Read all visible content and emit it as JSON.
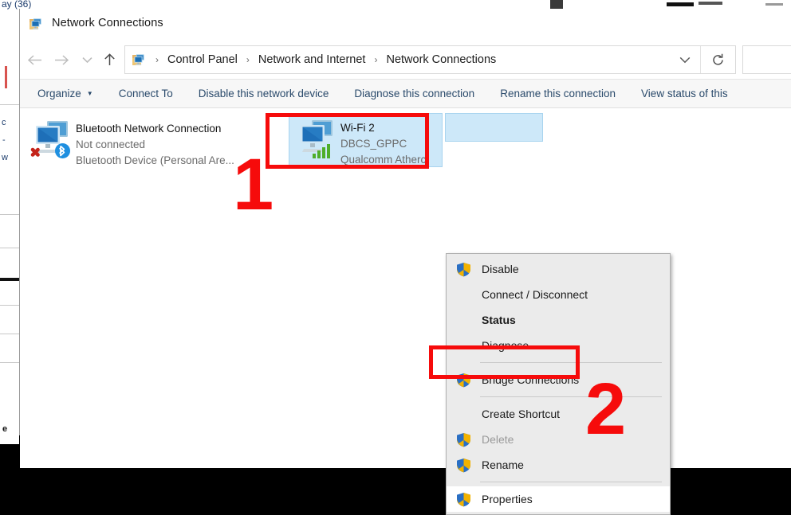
{
  "window": {
    "title": "Network Connections",
    "title_icon": "network-connections-icon"
  },
  "navigation": {
    "back_icon": "←",
    "forward_icon": "→",
    "recent_icon": "⌄",
    "up_icon": "↑",
    "breadcrumb": [
      "Control Panel",
      "Network and Internet",
      "Network Connections"
    ],
    "separator": "›",
    "chevron_icon": "⌄",
    "refresh_icon": "↻"
  },
  "commandbar": {
    "items": [
      {
        "label": "Organize",
        "has_caret": true
      },
      {
        "label": "Connect To",
        "has_caret": false
      },
      {
        "label": "Disable this network device",
        "has_caret": false
      },
      {
        "label": "Diagnose this connection",
        "has_caret": false
      },
      {
        "label": "Rename this connection",
        "has_caret": false
      },
      {
        "label": "View status of this",
        "has_caret": false
      }
    ],
    "caret": "▼"
  },
  "adapters": [
    {
      "name": "Bluetooth Network Connection",
      "status": "Not connected",
      "device": "Bluetooth Device (Personal Are...",
      "selected": false,
      "icon": "network-adapter-disconnected-bluetooth-icon"
    },
    {
      "name": "Wi-Fi 2",
      "status": "DBCS_GPPC",
      "device": "Qualcomm Atherc",
      "selected": true,
      "icon": "network-adapter-wifi-icon"
    }
  ],
  "context_menu": {
    "items": [
      {
        "label": "Disable",
        "shield": true,
        "bold": false,
        "disabled": false,
        "separator_after": false,
        "highlight": false
      },
      {
        "label": "Connect / Disconnect",
        "shield": false,
        "bold": false,
        "disabled": false,
        "separator_after": false,
        "highlight": false
      },
      {
        "label": "Status",
        "shield": false,
        "bold": true,
        "disabled": false,
        "separator_after": false,
        "highlight": false
      },
      {
        "label": "Diagnose",
        "shield": false,
        "bold": false,
        "disabled": false,
        "separator_after": true,
        "highlight": false
      },
      {
        "label": "Bridge Connections",
        "shield": true,
        "bold": false,
        "disabled": false,
        "separator_after": true,
        "highlight": false
      },
      {
        "label": "Create Shortcut",
        "shield": false,
        "bold": false,
        "disabled": false,
        "separator_after": false,
        "highlight": false
      },
      {
        "label": "Delete",
        "shield": true,
        "bold": false,
        "disabled": true,
        "separator_after": false,
        "highlight": false
      },
      {
        "label": "Rename",
        "shield": true,
        "bold": false,
        "disabled": false,
        "separator_after": true,
        "highlight": false
      },
      {
        "label": "Properties",
        "shield": true,
        "bold": false,
        "disabled": false,
        "separator_after": false,
        "highlight": true
      }
    ]
  },
  "annotations": {
    "step_one": "1",
    "step_two": "2",
    "color": "#f60b0b"
  },
  "background": {
    "fragment_text_1": "ay (36)",
    "fragment_text_2": "c",
    "fragment_text_3": "-",
    "fragment_text_4": "w",
    "fragment_text_5": "e"
  }
}
